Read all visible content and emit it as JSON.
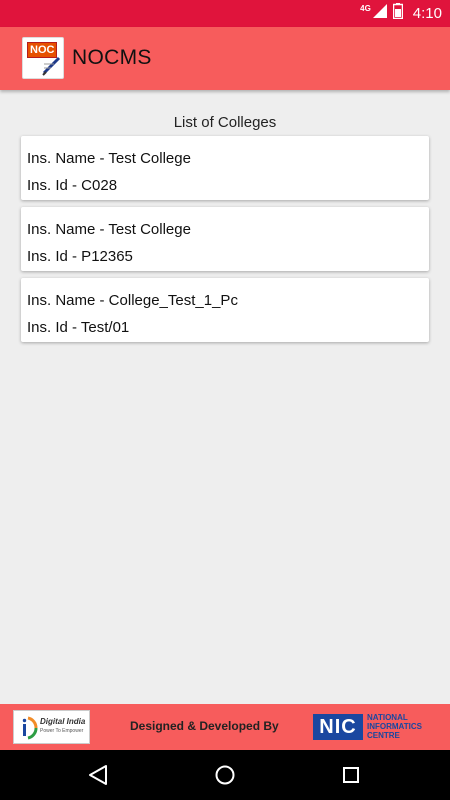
{
  "status_bar": {
    "network": "4G",
    "time": "4:10"
  },
  "app_bar": {
    "logo_text": "NOC",
    "title": "NOCMS"
  },
  "list": {
    "heading": "List of Colleges",
    "items": [
      {
        "name": "Ins. Name - Test College",
        "id": "Ins. Id - C028"
      },
      {
        "name": "Ins. Name - Test College",
        "id": "Ins. Id - P12365"
      },
      {
        "name": "Ins. Name - College_Test_1_Pc",
        "id": "Ins. Id - Test/01"
      }
    ]
  },
  "footer": {
    "left_logo_title": "Digital India",
    "left_logo_subtitle": "Power To Empower",
    "text": "Designed & Developed By",
    "right_logo_mark": "NIC",
    "right_logo_line1": "NATIONAL",
    "right_logo_line2": "INFORMATICS",
    "right_logo_line3": "CENTRE"
  },
  "nav_bar": {
    "buttons": [
      "back-icon",
      "home-icon",
      "recents-icon"
    ]
  },
  "colors": {
    "status_bar": "#e0143c",
    "app_bar": "#f75c5c",
    "background": "#eeeeee",
    "card": "#ffffff",
    "nic_blue": "#1a47a0"
  }
}
